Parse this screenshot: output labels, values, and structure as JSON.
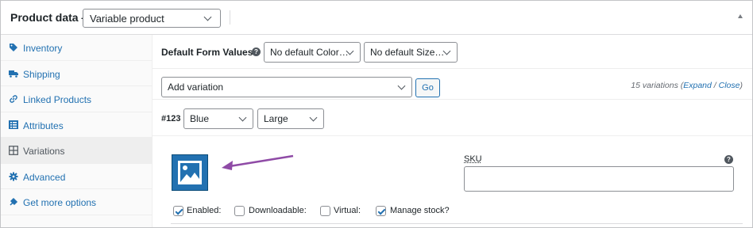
{
  "header": {
    "title": "Product data —",
    "product_type": "Variable product"
  },
  "sidebar": {
    "items": [
      {
        "label": "Inventory",
        "icon": "tag-icon"
      },
      {
        "label": "Shipping",
        "icon": "truck-icon"
      },
      {
        "label": "Linked Products",
        "icon": "link-icon"
      },
      {
        "label": "Attributes",
        "icon": "list-icon"
      },
      {
        "label": "Variations",
        "icon": "grid-icon"
      },
      {
        "label": "Advanced",
        "icon": "gear-icon"
      },
      {
        "label": "Get more options",
        "icon": "plugin-icon"
      }
    ]
  },
  "defaults": {
    "label": "Default Form Values:",
    "color_select": "No default Color…",
    "size_select": "No default Size…"
  },
  "toolbar": {
    "action_select": "Add variation",
    "go_label": "Go",
    "count_text": "15 variations (",
    "expand_link": "Expand",
    "separator": " / ",
    "close_link": "Close",
    "count_end": ")"
  },
  "variation": {
    "number": "#123",
    "color_value": "Blue",
    "size_value": "Large",
    "sku_label": "SKU",
    "sku_value": "",
    "checkboxes": [
      {
        "label": "Enabled:",
        "checked": true
      },
      {
        "label": "Downloadable:",
        "checked": false
      },
      {
        "label": "Virtual:",
        "checked": false
      },
      {
        "label": "Manage stock?",
        "checked": true
      }
    ]
  },
  "colors": {
    "accent": "#2271b1",
    "annotation_arrow": "#8f4ba6"
  }
}
